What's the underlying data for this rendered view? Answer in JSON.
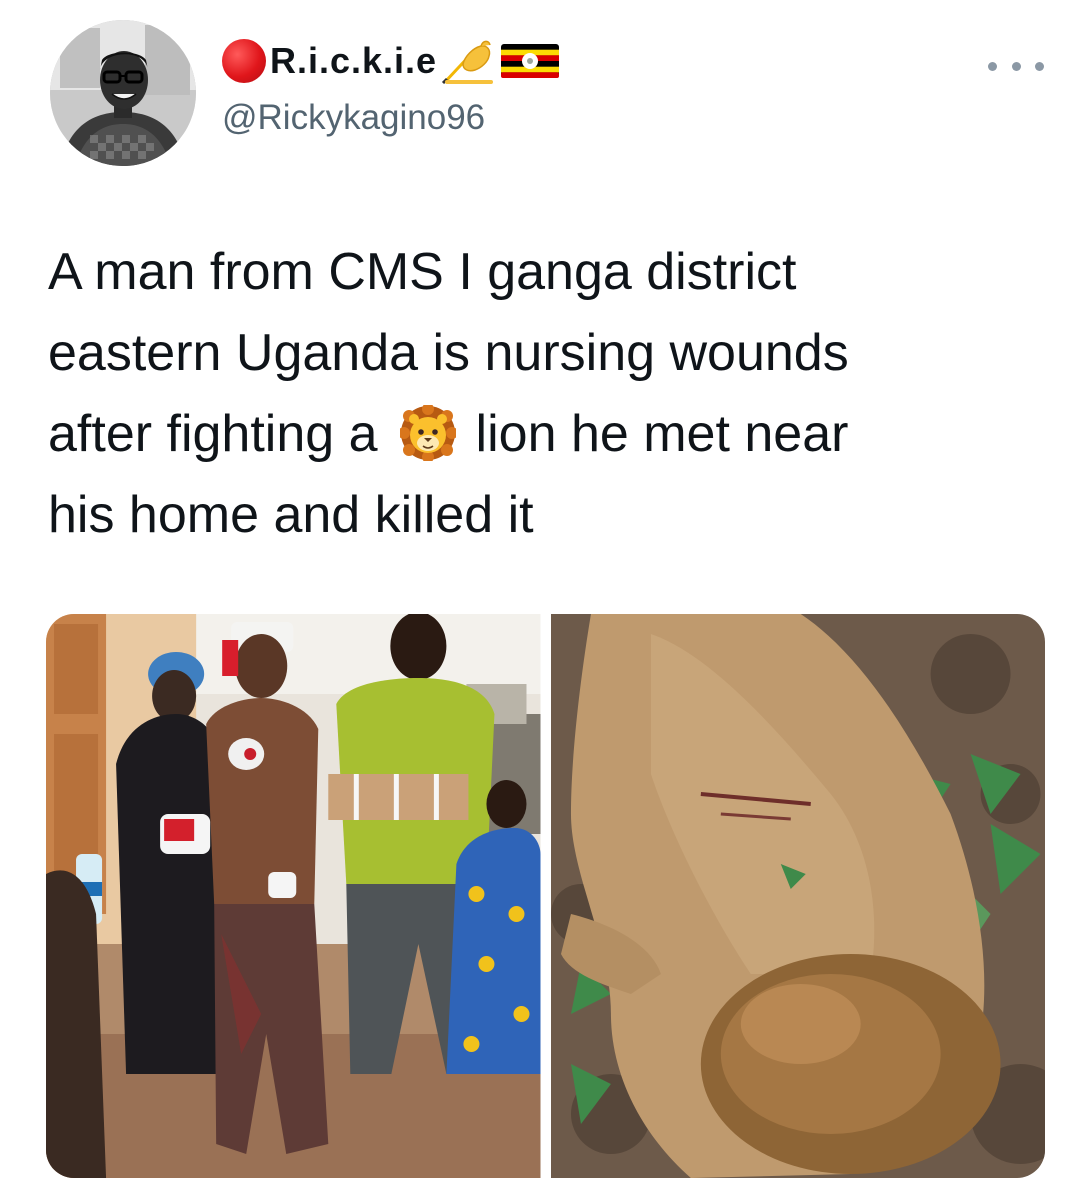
{
  "author": {
    "display_name": "R.i.c.k.i.e",
    "handle": "@Rickykagino96",
    "avatar_icon": "profile-photo",
    "badges": [
      "red-circle-icon",
      "writing-hand-icon",
      "uganda-flag-icon"
    ]
  },
  "menu": {
    "icon": "more-options-icon"
  },
  "tweet": {
    "lines": [
      "A man from CMS I ganga district",
      "eastern Uganda is nursing wounds",
      "after fighting a",
      "lion he met near",
      "his home and killed it"
    ],
    "inline_emoji": "lion-face-icon"
  },
  "media": [
    {
      "name": "injured-man-photo"
    },
    {
      "name": "dead-lion-photo"
    }
  ],
  "colors": {
    "text": "#0f1419",
    "secondary": "#536471",
    "accent_red": "#e0161b"
  }
}
